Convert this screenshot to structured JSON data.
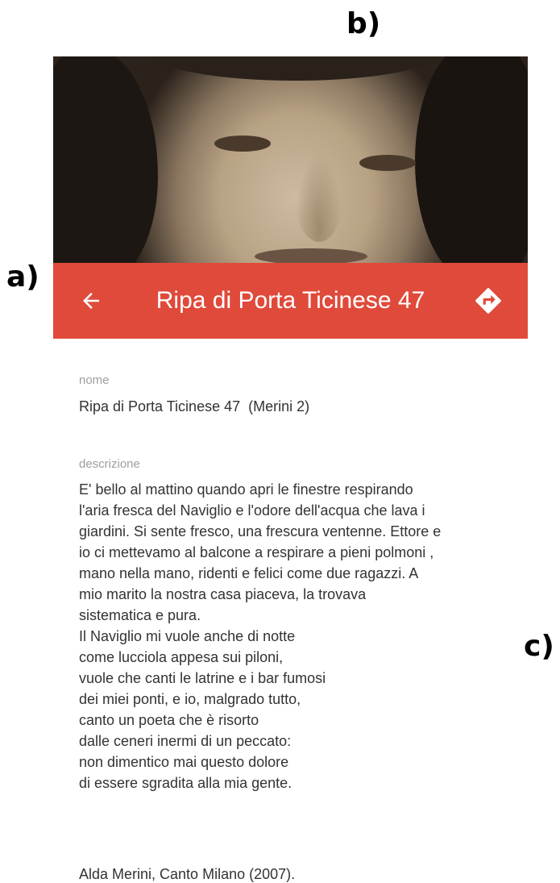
{
  "annotations": {
    "a": "a)",
    "b": "b)",
    "c": "c)"
  },
  "header": {
    "title": "Ripa di Porta Ticinese 47",
    "back_icon": "arrow-left-icon",
    "directions_icon": "directions-icon",
    "background_color": "#e04a3b"
  },
  "details": {
    "nome_label": "nome",
    "nome_value": "Ripa di Porta Ticinese 47  (Merini 2)",
    "descrizione_label": "descrizione",
    "descrizione_lines": [
      "E' bello al mattino quando apri le finestre respirando",
      "l'aria fresca del Naviglio e l'odore dell'acqua che lava i",
      "giardini. Si sente fresco, una frescura ventenne. Ettore e",
      "io ci mettevamo al balcone a respirare a pieni polmoni ,",
      "mano nella mano, ridenti e felici come due ragazzi. A",
      "mio marito la nostra casa piaceva, la trovava",
      "sistematica e pura.",
      "Il Naviglio mi vuole anche di notte",
      "come lucciola appesa sui piloni,",
      "vuole che canti le latrine e i bar fumosi",
      "dei miei ponti, e io, malgrado tutto,",
      "canto un poeta che è risorto",
      "dalle ceneri inermi di un peccato:",
      "non dimentico mai questo dolore",
      "di essere sgradita alla mia gente."
    ],
    "citation": "Alda Merini, Canto Milano (2007)."
  }
}
